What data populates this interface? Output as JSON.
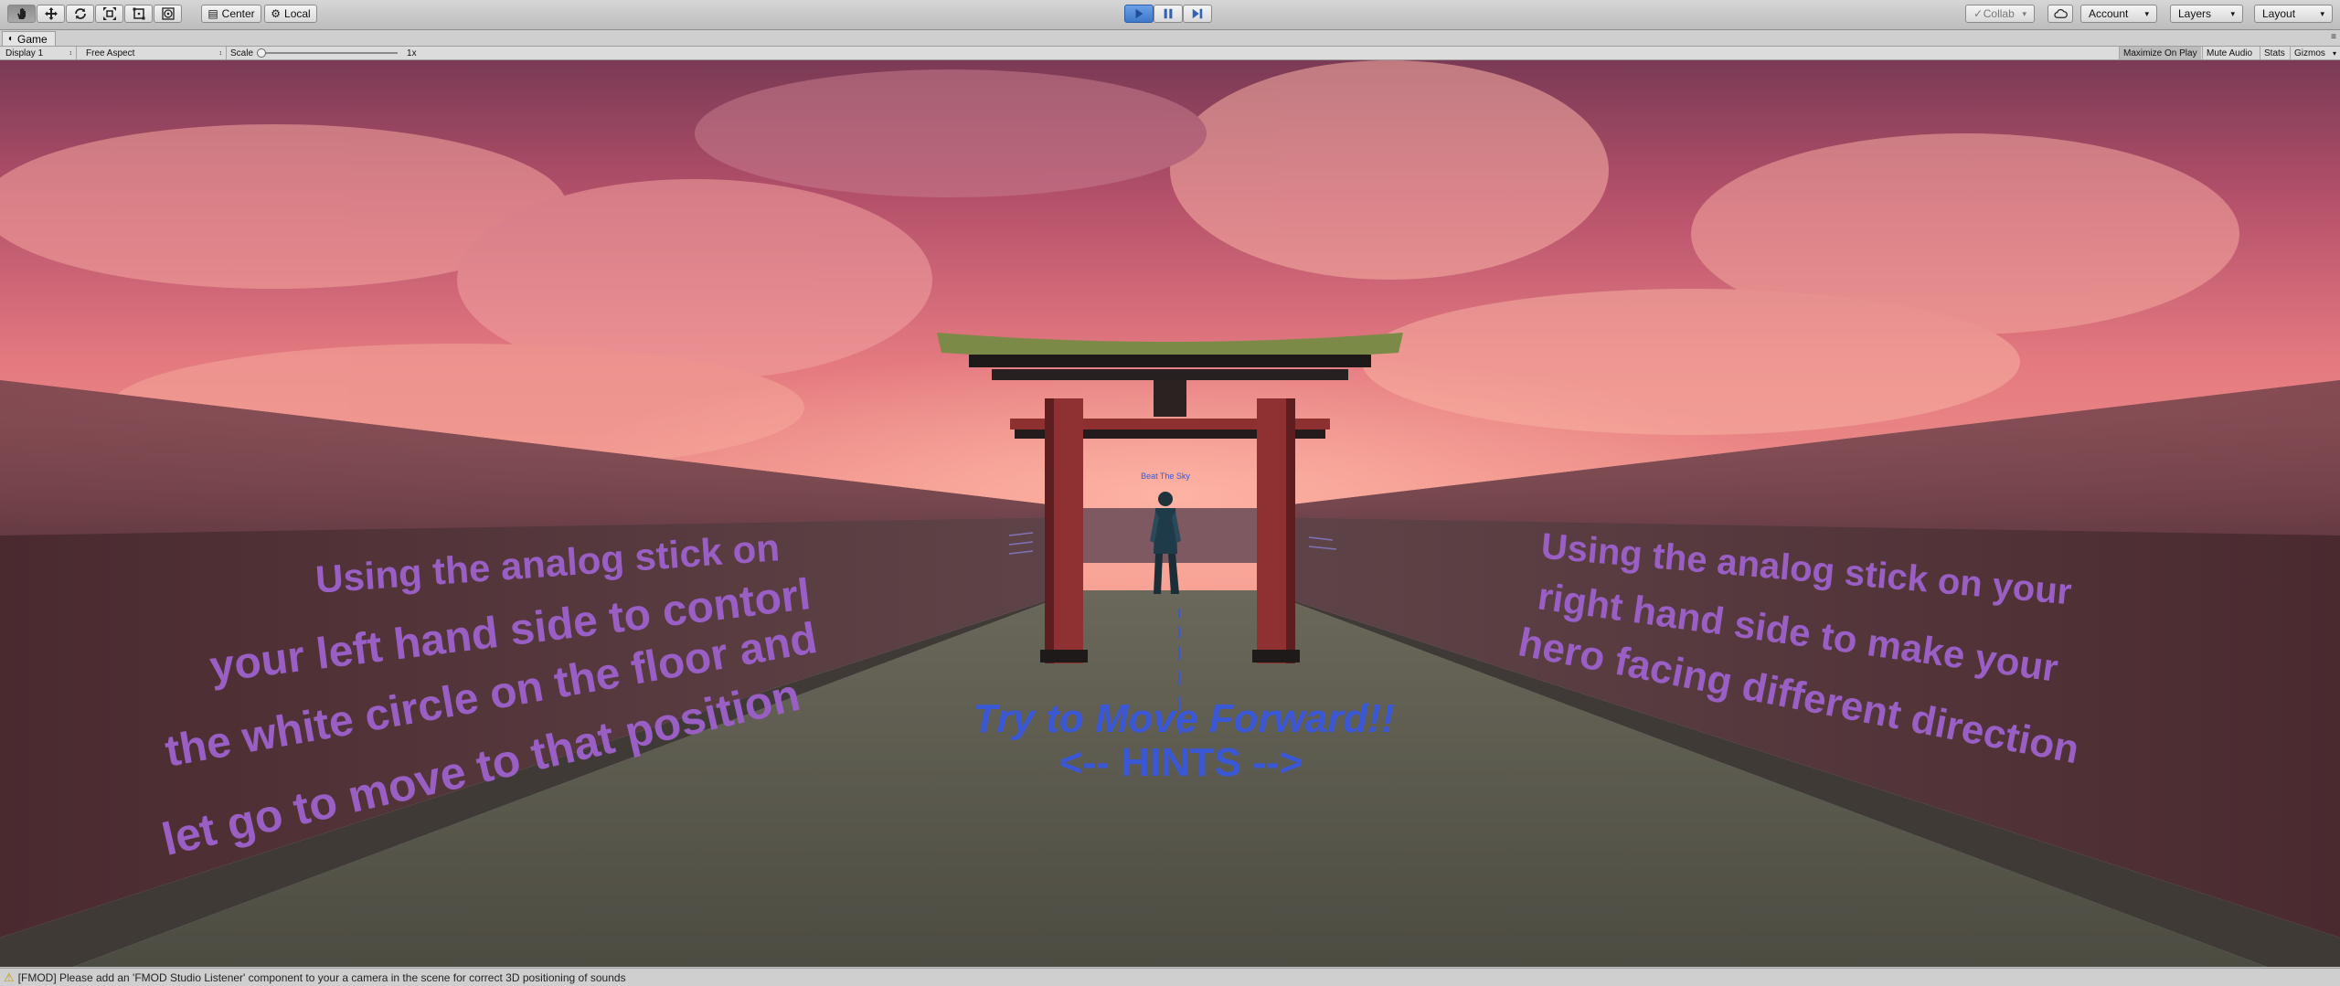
{
  "toolbar": {
    "tools": [
      "hand-tool",
      "move-tool",
      "rotate-tool",
      "scale-tool",
      "rect-tool",
      "transform-tool"
    ],
    "pivot_center": "Center",
    "pivot_local": "Local",
    "collab": "Collab",
    "account": "Account",
    "layers": "Layers",
    "layout": "Layout",
    "accent": "#3d78c9"
  },
  "tab": {
    "title": "Game"
  },
  "game_bar": {
    "display": "Display 1",
    "aspect": "Free Aspect",
    "scale_label": "Scale",
    "scale_value": "1x",
    "maximize": "Maximize On Play",
    "mute": "Mute Audio",
    "stats": "Stats",
    "gizmos": "Gizmos"
  },
  "scene": {
    "left_wall_lines": [
      "Using the analog stick on",
      "your left hand side to contorl",
      "the white circle on the floor and",
      "let go to move to that position"
    ],
    "right_wall_lines": [
      "Using the analog stick on your",
      "right hand side to make your",
      "hero facing different direction"
    ],
    "floor_line_1": "Try to Move Forward!!",
    "floor_line_2": "<-- HINTS -->",
    "character_label": "Beat The Sky",
    "text_color": "#9a5fc4",
    "floor_text_color": "#3a57d6"
  },
  "status": {
    "message": "[FMOD] Please add an 'FMOD Studio Listener' component to your a camera in the scene for correct 3D positioning of sounds"
  }
}
